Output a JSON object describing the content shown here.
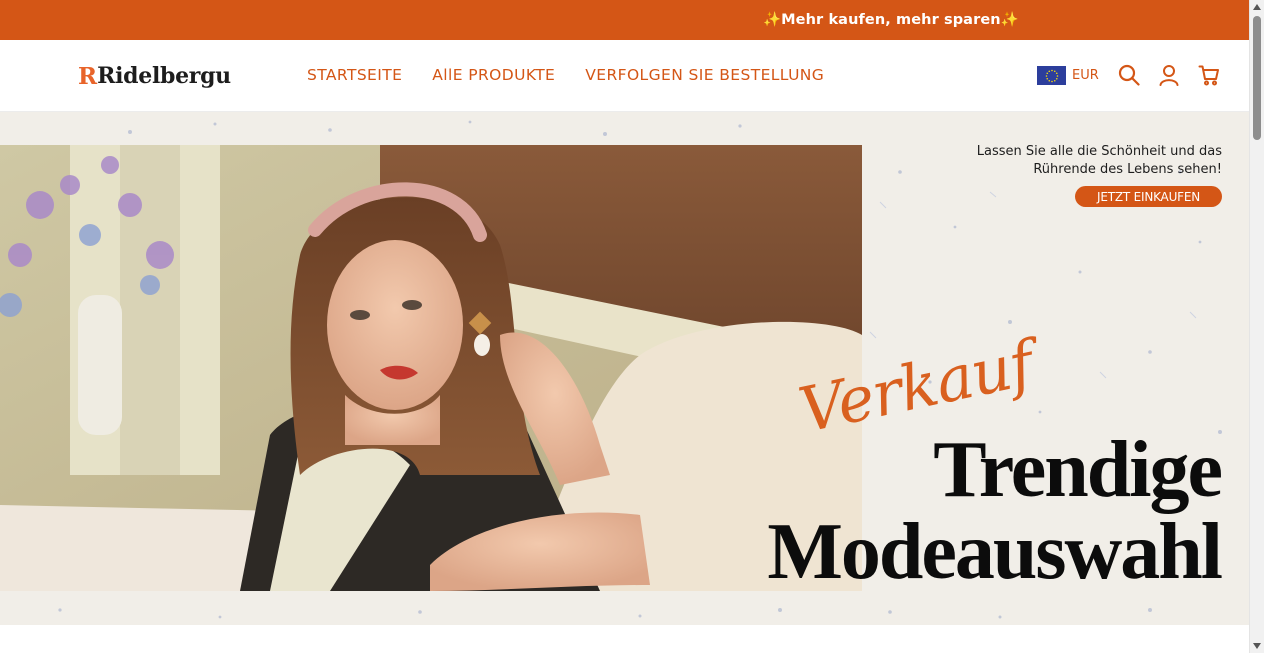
{
  "announcement": {
    "text": "✨Mehr kaufen, mehr sparen✨"
  },
  "header": {
    "logo_mark": "R",
    "logo_text": "Ridelbergu",
    "nav": [
      {
        "label": "STARTSEITE"
      },
      {
        "label": "AllE PRODUKTE"
      },
      {
        "label": "VERFOLGEN SIE BESTELLUNG"
      }
    ],
    "currency": "EUR",
    "icons": [
      "search-icon",
      "account-icon",
      "cart-icon"
    ]
  },
  "hero": {
    "tagline_line1": "Lassen Sie alle die Schönheit und das",
    "tagline_line2": "Rührende des Lebens sehen!",
    "cta_label": "JETZT EINKAUFEN",
    "script_word": "Verkauf",
    "headline_line1": "Trendige",
    "headline_line2": "Modeauswahl"
  },
  "colors": {
    "accent": "#d45616",
    "hero_background": "#f1eee8",
    "headline": "#0c0c0c"
  }
}
